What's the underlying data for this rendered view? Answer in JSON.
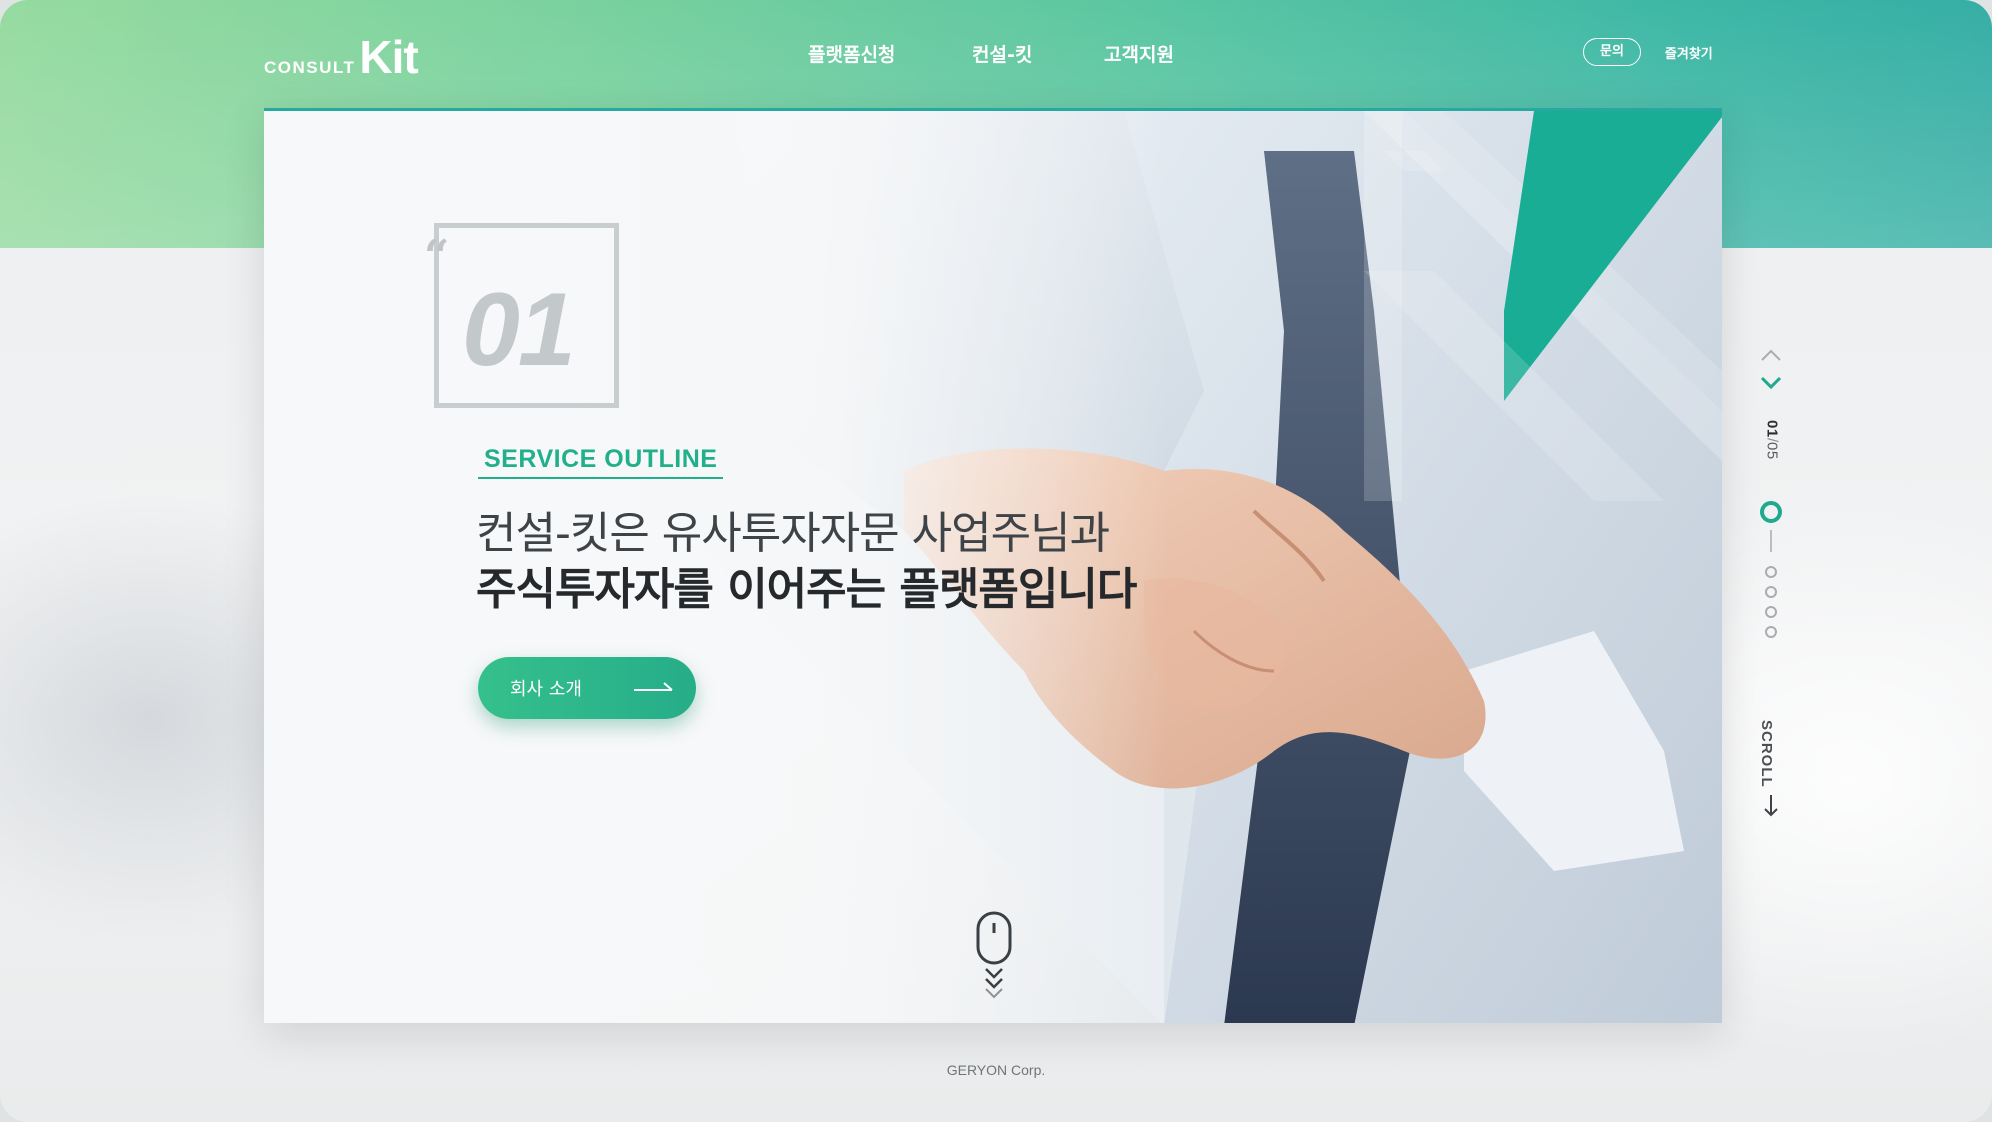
{
  "brand": {
    "logo_small": "CONSULT",
    "logo_large": "Kit"
  },
  "nav": {
    "items": [
      "플랫폼신청",
      "컨설-킷",
      "고객지원"
    ]
  },
  "util": {
    "inquiry": "문의",
    "favorite": "즐겨찾기"
  },
  "hero": {
    "slide_badge": "01",
    "outline_label": "SERVICE OUTLINE",
    "headline_line1": "컨설-킷은 유사투자자문 사업주님과",
    "headline_line2": "주식투자자를 이어주는 플랫폼입니다",
    "cta_label": "회사 소개",
    "accent_color": "#27a99f"
  },
  "rail": {
    "current": "01",
    "separator": "/",
    "total": "05",
    "active_index": 0,
    "dot_count": 5,
    "scroll_label": "SCROLL"
  },
  "footer": {
    "copyright": "GERYON Corp."
  }
}
